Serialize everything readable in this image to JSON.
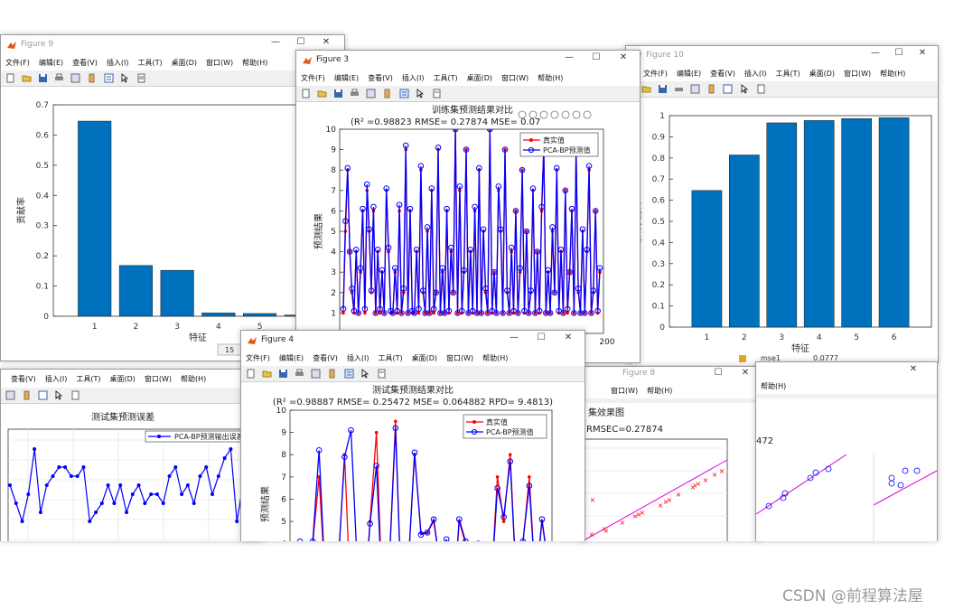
{
  "figure9": {
    "title": "Figure 9",
    "menu": [
      "文件(F)",
      "编辑(E)",
      "查看(V)",
      "插入(I)",
      "工具(T)",
      "桌面(D)",
      "窗口(W)",
      "帮助(H)"
    ],
    "ylabel": "贡献率",
    "xlabel": "特征",
    "yticks": [
      "0",
      "0.1",
      "0.2",
      "0.3",
      "0.4",
      "0.5",
      "0.6",
      "0.7"
    ],
    "xticks": [
      "1",
      "2",
      "3",
      "4",
      "5",
      "6"
    ],
    "status_number": "15"
  },
  "figure10": {
    "title": "Figure 10",
    "menu": [
      "文件(F)",
      "编辑(E)",
      "查看(V)",
      "插入(I)",
      "工具(T)",
      "桌面(D)",
      "窗口(W)",
      "帮助(H)"
    ],
    "ylabel": "累计贡献率",
    "xlabel": "特征",
    "yticks": [
      "0",
      "0.1",
      "0.2",
      "0.3",
      "0.4",
      "0.5",
      "0.6",
      "0.7",
      "0.8",
      "0.9",
      "1"
    ],
    "xticks": [
      "1",
      "2",
      "3",
      "4",
      "5",
      "6"
    ],
    "under_label": "mse1",
    "under_value": "0.0777"
  },
  "figure3": {
    "title": "Figure 3",
    "menu": [
      "文件(F)",
      "编辑(E)",
      "查看(V)",
      "插入(I)",
      "工具(T)",
      "桌面(D)",
      "窗口(W)",
      "帮助(H)"
    ],
    "plot_title": "训练集预测结果对比",
    "metrics": "(R² =0.98823 RMSE= 0.27874 MSE= 0.07",
    "ylabel": "预测结果",
    "yticks": [
      "1",
      "2",
      "3",
      "4",
      "5",
      "6",
      "7",
      "8",
      "9",
      "10"
    ],
    "xtick_visible": "200",
    "legend": [
      "真实值",
      "PCA-BP预测值"
    ]
  },
  "figure4": {
    "title": "Figure 4",
    "menu": [
      "文件(F)",
      "编辑(E)",
      "查看(V)",
      "插入(I)",
      "工具(T)",
      "桌面(D)",
      "窗口(W)",
      "帮助(H)"
    ],
    "plot_title": "测试集预测结果对比",
    "metrics": "(R² =0.98887 RMSE= 0.25472 MSE= 0.064882 RPD= 9.4813)",
    "ylabel": "预测结果",
    "yticks": [
      "4",
      "5",
      "6",
      "7",
      "8",
      "9",
      "10"
    ],
    "legend": [
      "真实值",
      "PCA-BP预测值"
    ]
  },
  "error_fig": {
    "menu": [
      "查看(V)",
      "插入(I)",
      "工具(T)",
      "桌面(D)",
      "窗口(W)",
      "帮助(H)"
    ],
    "plot_title": "测试集预测误差",
    "legend": [
      "PCA-BP预测输出误差"
    ]
  },
  "fig8": {
    "title": "Figure 8",
    "menu": [
      "窗口(W)",
      "帮助(H)"
    ],
    "plot_title": "集效果图",
    "metrics": "RMSEC=0.27874"
  },
  "fig_right": {
    "menu": [
      "帮助(H)"
    ],
    "metrics_partial": "472"
  },
  "watermark": "CSDN @前程算法屋",
  "chart_data": [
    {
      "type": "bar",
      "title": "",
      "xlabel": "特征",
      "ylabel": "贡献率",
      "categories": [
        "1",
        "2",
        "3",
        "4",
        "5",
        "6"
      ],
      "values": [
        0.646,
        0.168,
        0.152,
        0.011,
        0.009,
        0.004
      ],
      "ylim": [
        0,
        0.7
      ],
      "color": "#0072bd"
    },
    {
      "type": "bar",
      "title": "",
      "xlabel": "特征",
      "ylabel": "累计贡献率",
      "categories": [
        "1",
        "2",
        "3",
        "4",
        "5",
        "6"
      ],
      "values": [
        0.646,
        0.814,
        0.966,
        0.977,
        0.986,
        0.99
      ],
      "ylim": [
        0,
        1
      ],
      "color": "#0072bd"
    },
    {
      "type": "line",
      "title": "训练集预测结果对比",
      "ylabel": "预测结果",
      "ylim": [
        0,
        10
      ],
      "legend": "top-right",
      "series": [
        {
          "name": "真实值",
          "color": "#ff0000",
          "values": [
            1,
            5,
            8,
            4,
            2,
            1,
            4,
            1,
            3,
            6,
            1,
            7,
            5,
            2,
            6,
            1,
            4,
            1,
            3,
            1,
            7,
            4,
            1,
            1,
            3,
            1,
            6,
            1,
            2,
            9,
            1,
            6,
            1,
            1,
            4,
            1,
            8,
            2,
            1,
            5,
            1,
            7,
            1,
            2,
            9,
            1,
            3,
            1,
            6,
            1,
            4,
            2,
            10,
            1,
            7,
            1,
            3,
            9,
            1,
            4,
            1,
            6,
            1,
            8,
            1,
            5,
            2,
            1,
            10,
            1,
            3,
            1,
            7,
            5,
            1,
            9,
            2,
            1,
            4,
            1,
            6,
            1,
            3,
            8,
            1,
            5,
            1,
            2,
            7,
            1,
            4,
            1,
            6,
            9,
            1,
            3,
            1,
            5,
            2,
            8,
            1,
            4,
            1,
            7,
            1,
            3,
            6,
            1,
            9,
            2,
            1,
            5,
            1,
            4,
            8,
            1,
            2,
            6,
            1,
            3
          ]
        },
        {
          "name": "PCA-BP预测值",
          "color": "#0000ff",
          "values": [
            1.2,
            5.5,
            8.1,
            4.0,
            2.2,
            1.1,
            4.1,
            1.0,
            3.2,
            6.1,
            1.2,
            7.3,
            5.1,
            2.1,
            6.2,
            1.0,
            4.1,
            1.2,
            3.1,
            1.0,
            7.1,
            4.2,
            1.1,
            1.0,
            3.2,
            1.1,
            6.3,
            1.0,
            2.2,
            9.2,
            1.0,
            6.1,
            1.1,
            1.0,
            4.1,
            1.2,
            8.2,
            2.1,
            1.0,
            5.2,
            1.0,
            7.1,
            1.2,
            2.0,
            9.1,
            1.0,
            3.2,
            1.0,
            6.1,
            1.1,
            4.2,
            2.0,
            10,
            1.0,
            7.2,
            1.1,
            3.1,
            9.0,
            1.0,
            4.1,
            1.1,
            6.2,
            1.0,
            8.1,
            1.0,
            5.1,
            2.2,
            1.0,
            10,
            1.1,
            3.0,
            1.0,
            7.2,
            5.1,
            1.0,
            9.0,
            2.1,
            1.0,
            4.2,
            1.1,
            6.0,
            1.0,
            3.2,
            8.0,
            1.1,
            5.0,
            1.0,
            2.1,
            7.1,
            1.0,
            4.0,
            1.1,
            6.2,
            9.1,
            1.0,
            3.1,
            1.0,
            5.2,
            2.0,
            8.1,
            1.1,
            4.1,
            1.0,
            7.0,
            1.2,
            3.0,
            6.1,
            1.0,
            9.0,
            2.2,
            1.0,
            5.1,
            1.0,
            4.1,
            8.2,
            1.0,
            2.1,
            6.0,
            1.1,
            3.2
          ]
        }
      ]
    },
    {
      "type": "line",
      "title": "测试集预测结果对比",
      "ylabel": "预测结果",
      "ylim": [
        3.5,
        10
      ],
      "legend": "top-right",
      "series": [
        {
          "name": "真实值",
          "color": "#ff0000",
          "values": [
            3,
            4,
            1,
            4,
            7,
            2,
            1,
            3,
            8,
            1,
            3,
            1,
            5,
            9,
            1,
            3,
            9.5,
            1,
            3,
            8,
            4.5,
            4.5,
            5,
            3,
            4,
            1,
            5,
            4,
            1,
            4,
            3,
            2,
            7,
            5,
            8,
            2,
            4,
            7,
            2,
            5,
            3
          ]
        },
        {
          "name": "PCA-BP预测值",
          "color": "#0000ff",
          "values": [
            3,
            4.1,
            1,
            4.1,
            8.2,
            2,
            1,
            3,
            7.9,
            9.1,
            3,
            1,
            4.9,
            7.5,
            1,
            3,
            9.2,
            1,
            3,
            8.1,
            4.4,
            4.5,
            5.1,
            3,
            4.2,
            1,
            5.1,
            4.1,
            1,
            4,
            3,
            2,
            6.5,
            5.2,
            7.7,
            2,
            4.1,
            6.6,
            2,
            5.1,
            3
          ]
        }
      ]
    },
    {
      "type": "line",
      "title": "测试集预测误差",
      "legend": "top-right",
      "series": [
        {
          "name": "PCA-BP预测输出误差",
          "color": "#0000ff",
          "values": [
            0.1,
            -0.1,
            -0.3,
            0.0,
            0.5,
            -0.2,
            0.1,
            0.2,
            0.3,
            0.3,
            0.2,
            0.2,
            0.3,
            -0.3,
            -0.2,
            -0.1,
            0.1,
            -0.1,
            0.1,
            -0.2,
            0.0,
            0.1,
            -0.1,
            0.0,
            0.0,
            -0.1,
            0.2,
            0.3,
            0.0,
            0.1,
            -0.1,
            0.2,
            0.3,
            0.0,
            0.2,
            0.4,
            0.5,
            -0.3,
            0.1
          ]
        }
      ]
    }
  ]
}
